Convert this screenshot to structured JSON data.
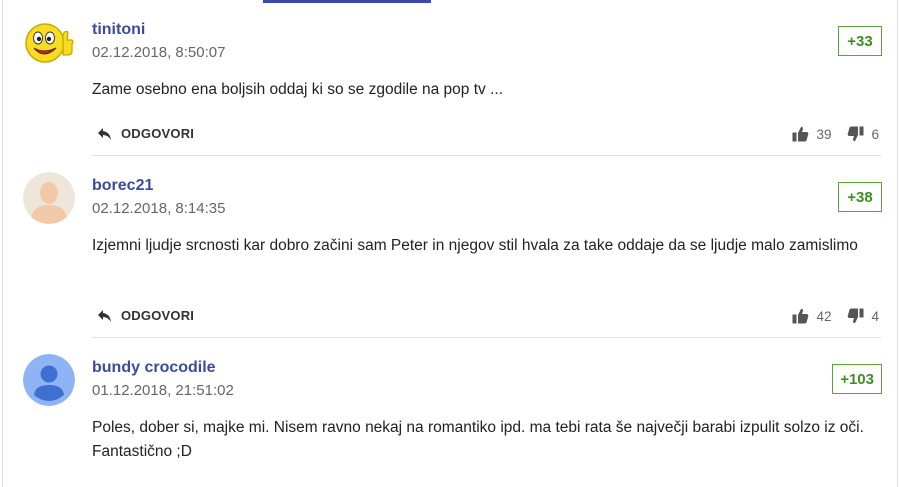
{
  "comments": [
    {
      "username": "tinitoni",
      "timestamp": "02.12.2018, 8:50:07",
      "score": "+33",
      "text": "Zame osebno ena boljsih oddaj ki so se zgodile na pop tv ...",
      "reply_label": "ODGOVORI",
      "likes": "39",
      "dislikes": "6",
      "avatar": "smiley-thumbs-up"
    },
    {
      "username": "borec21",
      "timestamp": "02.12.2018, 8:14:35",
      "score": "+38",
      "text": "Izjemni ljudje srcnosti kar dobro začini sam Peter in njegov stil hvala za take oddaje da se ljudje malo zamislimo",
      "reply_label": "ODGOVORI",
      "likes": "42",
      "dislikes": "4",
      "avatar": "default-person"
    },
    {
      "username": "bundy crocodile",
      "timestamp": "01.12.2018, 21:51:02",
      "score": "+103",
      "text": "Poles, dober si, majke mi. Nisem ravno nekaj na romantiko ipd. ma tebi rata še največji barabi izpulit solzo iz oči. Fantastično ;D",
      "avatar": "default-user-blue"
    }
  ],
  "colors": {
    "username": "#3c4b9c",
    "score_border": "#58a63b",
    "score_text": "#3f8f23",
    "top_accent": "#3b4aa8"
  },
  "icons": {
    "reply": "reply-arrow-icon",
    "like": "thumbs-up-icon",
    "dislike": "thumbs-down-icon"
  }
}
